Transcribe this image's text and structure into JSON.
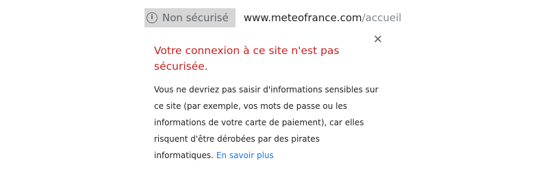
{
  "omnibox": {
    "security_label": "Non sécurisé",
    "url_domain": "www.meteofrance.com",
    "url_path": "/accueil"
  },
  "popup": {
    "title": "Votre connexion à ce site n'est pas sécurisée.",
    "body": "Vous ne devriez pas saisir d'informations sensibles sur ce site (par exemple, vos mots de passe ou les informations de votre carte de paiement), car elles risquent d'être dérobées par des pirates informatiques.",
    "learn_more": "En savoir plus",
    "close_glyph": "✕"
  },
  "icons": {
    "info": "info-circle-icon",
    "close": "close-icon"
  },
  "colors": {
    "warning_red": "#c5221f",
    "link_blue": "#1a73e8",
    "chip_background": "#d6d6d6"
  }
}
